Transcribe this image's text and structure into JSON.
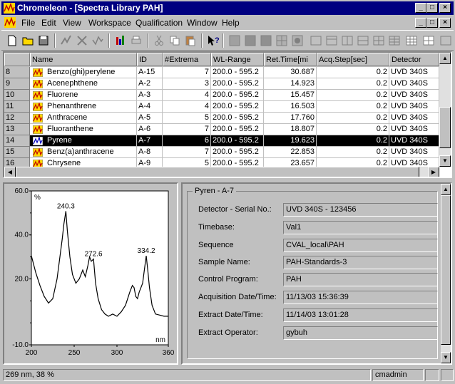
{
  "window": {
    "title": "Chromeleon - [Spectra Library PAH]",
    "controls": {
      "minimize": "_",
      "maximize": "□",
      "close": "×"
    }
  },
  "menu": [
    "File",
    "Edit",
    "View",
    "Workspace",
    "Qualification",
    "Window",
    "Help"
  ],
  "table": {
    "columns": [
      "Name",
      "ID",
      "#Extrema",
      "WL-Range",
      "Ret.Time[mi",
      "Acq.Step[sec]",
      "Detector"
    ],
    "rows": [
      {
        "n": "8",
        "name": "Benzo(ghi)perylene",
        "id": "A-15",
        "ext": "7",
        "wl": "200.0 - 595.2",
        "rt": "30.687",
        "step": "0.2",
        "det": "UVD 340S"
      },
      {
        "n": "9",
        "name": "Acenephthene",
        "id": "A-2",
        "ext": "3",
        "wl": "200.0 - 595.2",
        "rt": "14.923",
        "step": "0.2",
        "det": "UVD 340S"
      },
      {
        "n": "10",
        "name": "Fluorene",
        "id": "A-3",
        "ext": "4",
        "wl": "200.0 - 595.2",
        "rt": "15.457",
        "step": "0.2",
        "det": "UVD 340S"
      },
      {
        "n": "11",
        "name": "Phenanthrene",
        "id": "A-4",
        "ext": "4",
        "wl": "200.0 - 595.2",
        "rt": "16.503",
        "step": "0.2",
        "det": "UVD 340S"
      },
      {
        "n": "12",
        "name": "Anthracene",
        "id": "A-5",
        "ext": "5",
        "wl": "200.0 - 595.2",
        "rt": "17.760",
        "step": "0.2",
        "det": "UVD 340S"
      },
      {
        "n": "13",
        "name": "Fluoranthene",
        "id": "A-6",
        "ext": "7",
        "wl": "200.0 - 595.2",
        "rt": "18.807",
        "step": "0.2",
        "det": "UVD 340S"
      },
      {
        "n": "14",
        "name": "Pyrene",
        "id": "A-7",
        "ext": "6",
        "wl": "200.0 - 595.2",
        "rt": "19.623",
        "step": "0.2",
        "det": "UVD 340S"
      },
      {
        "n": "15",
        "name": "Benz(a)anthracene",
        "id": "A-8",
        "ext": "7",
        "wl": "200.0 - 595.2",
        "rt": "22.853",
        "step": "0.2",
        "det": "UVD 340S"
      },
      {
        "n": "16",
        "name": "Chrysene",
        "id": "A-9",
        "ext": "5",
        "wl": "200.0 - 595.2",
        "rt": "23.657",
        "step": "0.2",
        "det": "UVD 340S"
      }
    ],
    "selected_index": 6
  },
  "chart_data": {
    "type": "line",
    "ylabel": "%",
    "xlabel": "nm",
    "xlim": [
      200,
      360
    ],
    "ylim": [
      -10.0,
      60.0
    ],
    "xticks": [
      "200",
      "250",
      "300",
      "360"
    ],
    "yticks": [
      "60.0",
      "40.0",
      "20.0",
      "-10.0"
    ],
    "annotations": [
      {
        "x": 240.3,
        "y": 50.8,
        "label": "240.3"
      },
      {
        "x": 272.6,
        "y": 29.0,
        "label": "272.6"
      },
      {
        "x": 334.2,
        "y": 30.5,
        "label": "334.2"
      }
    ],
    "x": [
      200,
      205,
      210,
      215,
      220,
      225,
      230,
      233,
      236,
      238,
      240.3,
      242,
      245,
      248,
      252,
      256,
      260,
      263,
      266,
      268,
      270,
      272.6,
      275,
      278,
      282,
      286,
      290,
      295,
      300,
      305,
      310,
      315,
      318,
      320,
      322,
      324,
      326,
      330,
      332,
      334.2,
      336,
      338,
      341,
      345,
      350,
      355,
      360
    ],
    "y": [
      30.5,
      23,
      17,
      12,
      9,
      11,
      20,
      29,
      38,
      45,
      50.8,
      42,
      30,
      22,
      18,
      20,
      24,
      21,
      26,
      30,
      28,
      29,
      18,
      11,
      6,
      4,
      3,
      4,
      3,
      5,
      8,
      14,
      17,
      16,
      12,
      11,
      14,
      18,
      24,
      30.5,
      24,
      16,
      8,
      4,
      3.5,
      3,
      3
    ],
    "grid": false,
    "legend": "none"
  },
  "info": {
    "group_title": "Pyren - A-7",
    "fields": [
      {
        "label": "Detector - Serial No.:",
        "value": "UVD 340S - 123456"
      },
      {
        "label": "Timebase:",
        "value": "Val1"
      },
      {
        "label": "Sequence",
        "value": "CVAL_local\\PAH"
      },
      {
        "label": "Sample Name:",
        "value": "PAH-Standards-3"
      },
      {
        "label": "Control Program:",
        "value": "PAH"
      },
      {
        "label": "Acquisition Date/Time:",
        "value": "11/13/03 15:36:39"
      },
      {
        "label": "Extract Date/Time:",
        "value": "11/14/03 13:01:28"
      },
      {
        "label": "Extract Operator:",
        "value": "gybuh"
      }
    ]
  },
  "status": {
    "position": "269 nm, 38 %",
    "user": "cmadmin"
  },
  "colors": {
    "titlebar": "#000080",
    "selection": "#000000",
    "face": "#c0c0c0"
  }
}
